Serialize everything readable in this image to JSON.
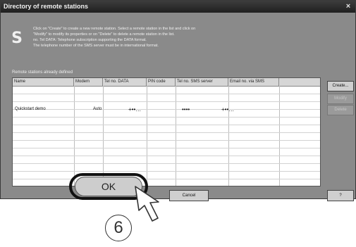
{
  "window": {
    "title": "Directory of remote stations",
    "close_label": "×"
  },
  "description": {
    "lines": [
      "Click on \"Create\" to create a new remote station. Select a remote station in the list and click on",
      "\"Modify\" to modify its properties or on \"Delete\" to delete a remote station in the list.",
      "no. Tel DATA: Telephone subscription supporting the DATA format.",
      "The telephone number of the SMS server must be in international format."
    ]
  },
  "table": {
    "section_label": "Remote stations already defined",
    "columns": [
      "Name",
      "Modem",
      "Tel no. DATA",
      "PIN code",
      "Tel no. SMS server",
      "Email no. via SMS"
    ],
    "rows": [
      {
        "name": "Quickstart demo",
        "modem": "Auto",
        "tel_data": "+••…",
        "pin": "••••",
        "sms_server": "+••…",
        "email": ""
      }
    ]
  },
  "buttons": {
    "create": "Create...",
    "modify": "Modify",
    "delete": "Delete",
    "ok": "OK",
    "cancel": "Cancel",
    "help": "?"
  },
  "annotation": {
    "step_number": "6"
  },
  "icons": {
    "info": "s-logo-icon",
    "cursor": "hand-pointer-icon"
  },
  "colors": {
    "dialog_bg": "#8a8a8a",
    "titlebar_bg": "#2a2a2a",
    "highlight_outline": "#111111"
  }
}
